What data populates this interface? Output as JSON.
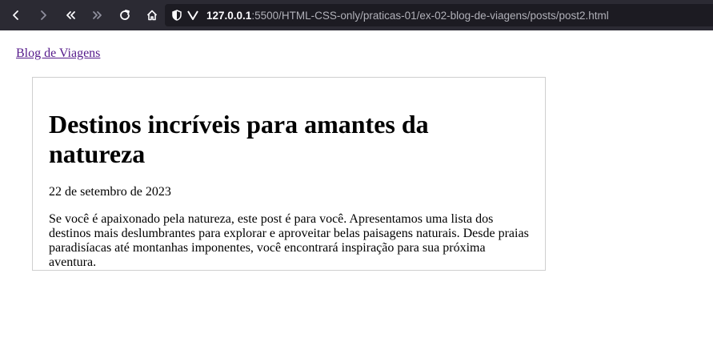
{
  "browser": {
    "url_host": "127.0.0.1",
    "url_rest": ":5500/HTML-CSS-only/praticas-01/ex-02-blog-de-viagens/posts/post2.html"
  },
  "page": {
    "nav_link": "Blog de Viagens",
    "post": {
      "title": "Destinos incríveis para amantes da natureza",
      "date": "22 de setembro de 2023",
      "body": "Se você é apaixonado pela natureza, este post é para você. Apresentamos uma lista dos destinos mais deslumbrantes para explorar e aproveitar belas paisagens naturais. Desde praias paradisíacas até montanhas imponentes, você encontrará inspiração para sua próxima aventura."
    }
  }
}
